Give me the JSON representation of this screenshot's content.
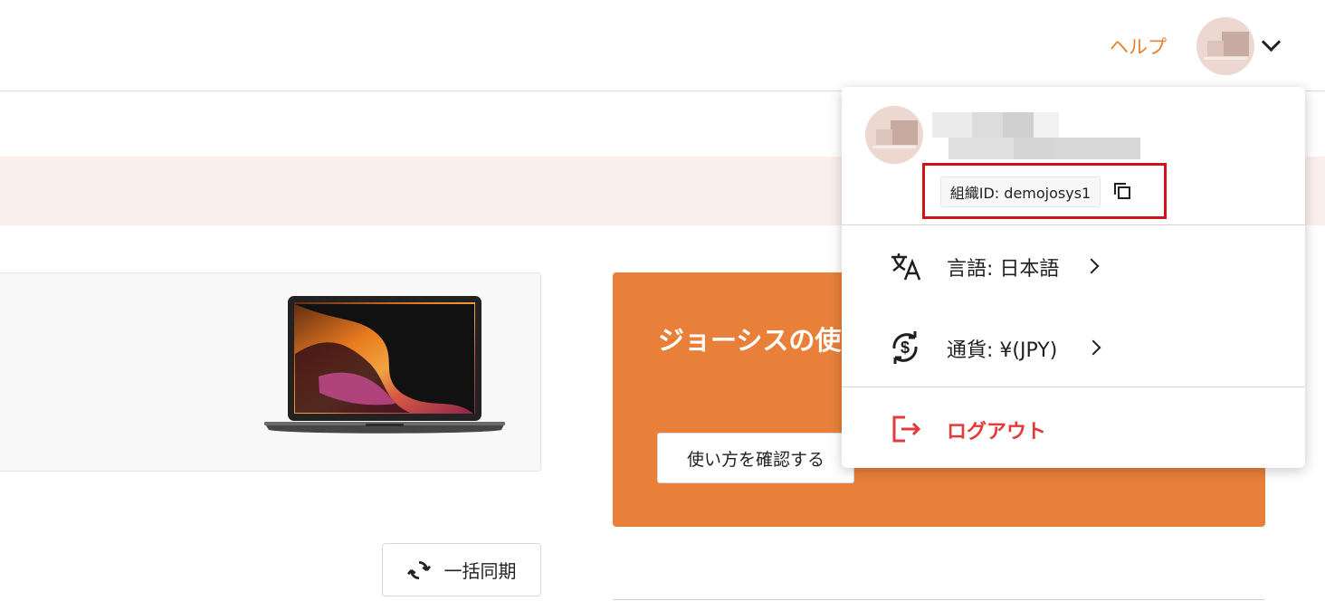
{
  "header": {
    "help_label": "ヘルプ"
  },
  "promo": {
    "title": "ジョーシスの使",
    "button_label": "使い方を確認する"
  },
  "sync": {
    "button_label": "一括同期"
  },
  "dropdown": {
    "org_id": "組織ID: demojosys1",
    "menu": {
      "language": "言語: 日本語",
      "currency": "通貨: ¥(JPY)",
      "logout": "ログアウト"
    }
  },
  "colors": {
    "accent": "#e8802f",
    "banner": "#fbefec",
    "logout": "#e23b3b",
    "highlight_border": "#d0101a"
  },
  "icons": {
    "copy": "copy-icon",
    "language": "translate-icon",
    "currency": "currency-exchange-icon",
    "logout": "logout-icon",
    "sync": "sync-icon",
    "chevron": "chevron-down-icon"
  }
}
